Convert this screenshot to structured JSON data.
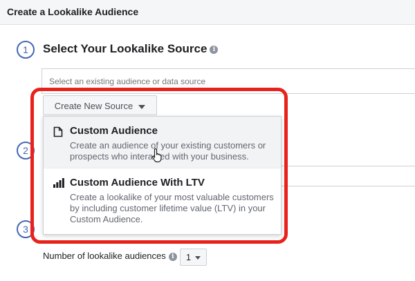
{
  "header": {
    "title": "Create a Lookalike Audience"
  },
  "steps": [
    "1",
    "2",
    "3"
  ],
  "source": {
    "title": "Select Your Lookalike Source",
    "info_icon": "i",
    "placeholder": "Select an existing audience or data source",
    "create_button_label": "Create New Source"
  },
  "dropdown": {
    "items": [
      {
        "title": "Custom Audience",
        "description": "Create an audience of your existing customers or prospects who interacted with your business.",
        "icon": "document-icon"
      },
      {
        "title": "Custom Audience With LTV",
        "description": "Create a lookalike of your most valuable customers by including customer lifetime value (LTV) in your Custom Audience.",
        "icon": "bar-chart-icon"
      }
    ]
  },
  "footer": {
    "label": "Number of lookalike audiences",
    "info_icon": "i",
    "count_value": "1"
  },
  "colors": {
    "accent": "#4267b2",
    "highlight_outline": "#e8221b"
  }
}
